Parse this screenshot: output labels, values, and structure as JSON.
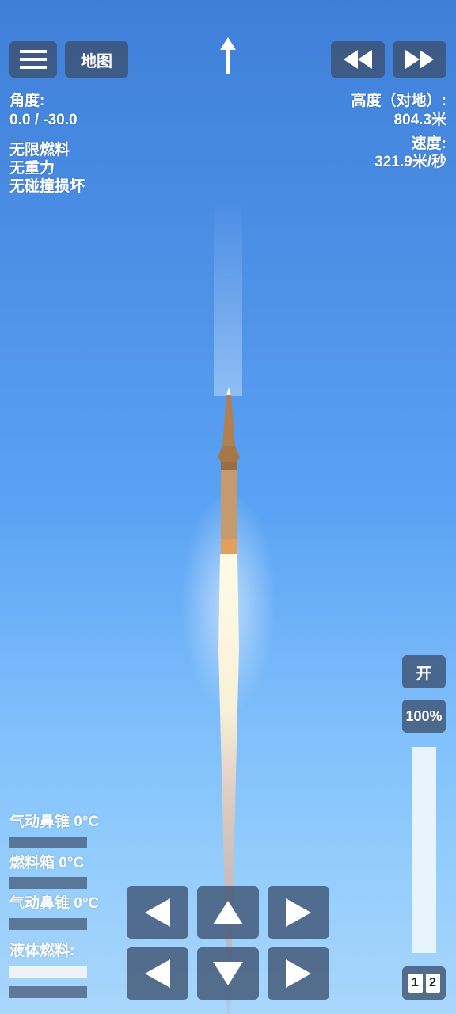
{
  "top_bar": {
    "menu_icon": "hamburger-menu-icon",
    "map_label": "地图",
    "rewind_icon": "rewind-icon",
    "fast_forward_icon": "fast-forward-icon",
    "heading_icon": "heading-arrow-icon"
  },
  "stats_left": {
    "angle_label": "角度:",
    "angle_value": "0.0 / -30.0",
    "cheats": [
      "无限燃料",
      "无重力",
      "无碰撞损坏"
    ]
  },
  "stats_right": {
    "altitude_label": "高度（对地）:",
    "altitude_value": "804.3米",
    "speed_label": "速度:",
    "speed_value": "321.9米/秒"
  },
  "parts": {
    "part1_label": "气动鼻锥 0°C",
    "part2_label": "燃料箱 0°C",
    "part3_label": "气动鼻锥 0°C",
    "fuel_label": "液体燃料:"
  },
  "throttle": {
    "engine_toggle": "开",
    "percent": "100%",
    "level": 1.0
  },
  "stage": {
    "one": "1",
    "two": "2"
  },
  "colors": {
    "button_bg": "#3c506e",
    "sky_top": "#3f7fd9",
    "sky_bottom": "#a9d6fb",
    "rocket": "#b98a5e"
  }
}
